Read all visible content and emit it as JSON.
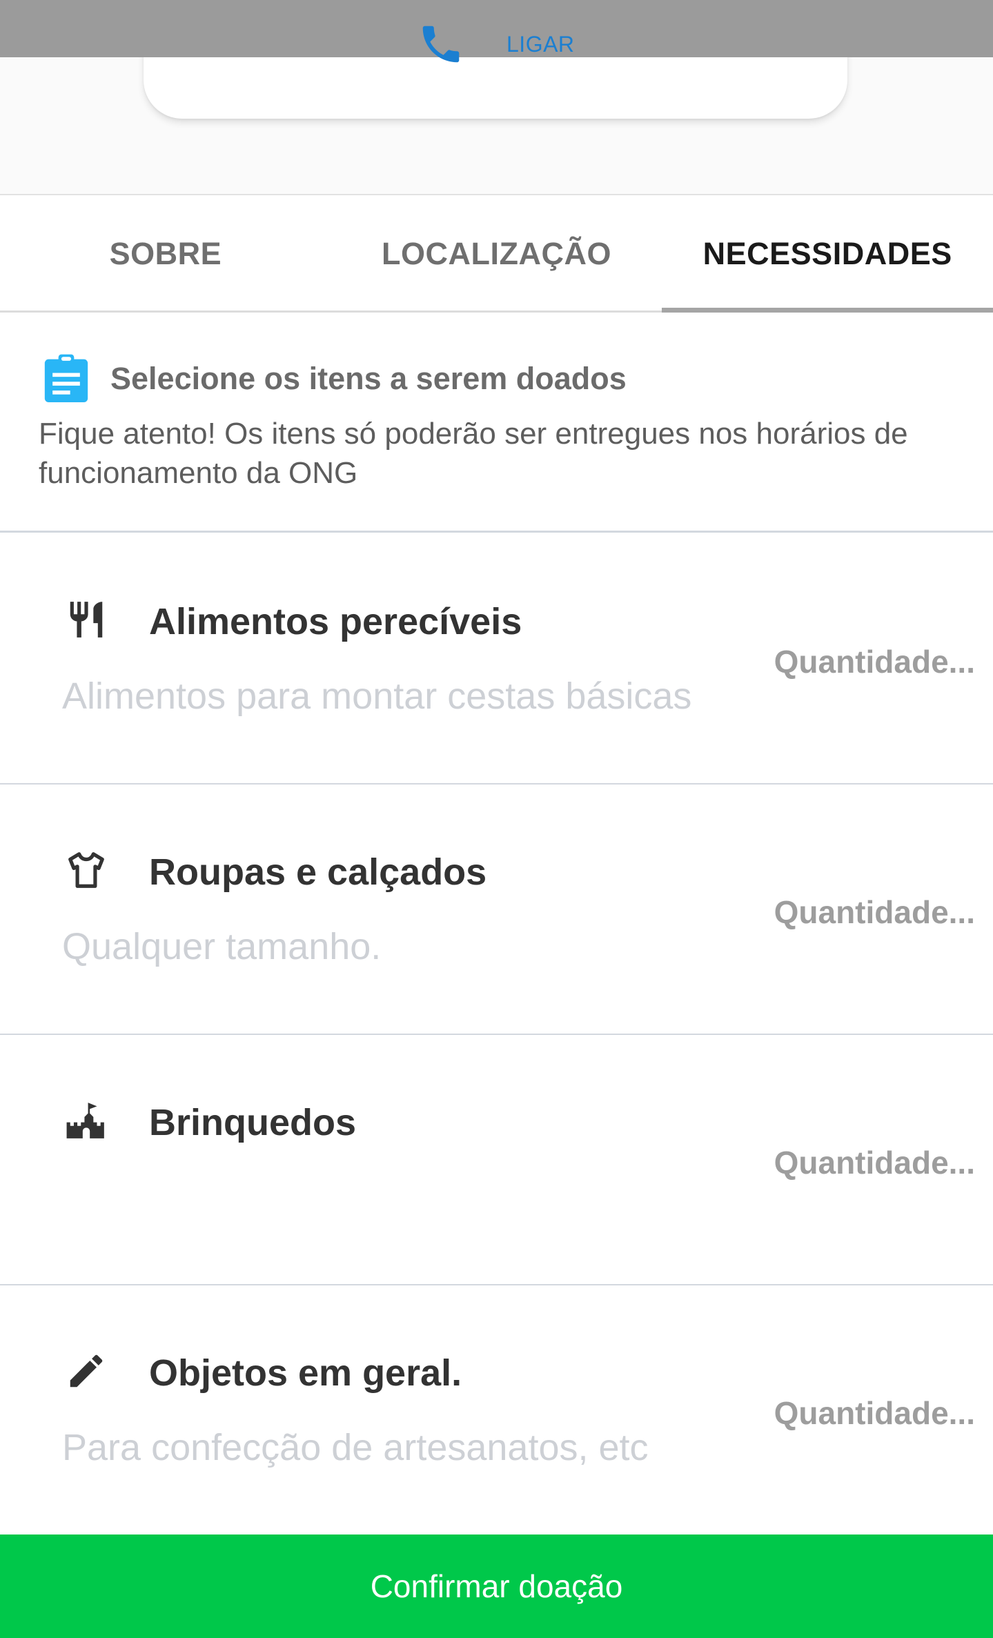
{
  "contact": {
    "call_label": "LIGAR",
    "icon": "phone-icon",
    "icon_color": "#1b7fd1"
  },
  "tabs": [
    {
      "label": "SOBRE",
      "active": false
    },
    {
      "label": "LOCALIZAÇÃO",
      "active": false
    },
    {
      "label": "NECESSIDADES",
      "active": true
    }
  ],
  "notice": {
    "icon": "clipboard-icon",
    "icon_color": "#29b6f6",
    "title": "Selecione os itens a serem doados",
    "text": "Fique atento! Os itens só poderão ser entregues nos horários de funcionamento da ONG"
  },
  "items": [
    {
      "icon": "fork-knife-icon",
      "title": "Alimentos perecíveis",
      "description": "Alimentos para montar cestas básicas",
      "quantity_placeholder": "Quantidade..."
    },
    {
      "icon": "tshirt-icon",
      "title": "Roupas e calçados",
      "description": "Qualquer tamanho.",
      "quantity_placeholder": "Quantidade..."
    },
    {
      "icon": "castle-icon",
      "title": "Brinquedos",
      "description": "",
      "quantity_placeholder": "Quantidade..."
    },
    {
      "icon": "pencil-icon",
      "title": "Objetos em geral.",
      "description": "Para confecção de artesanatos, etc",
      "quantity_placeholder": "Quantidade..."
    }
  ],
  "confirm": {
    "label": "Confirmar doação",
    "color": "#00c84a"
  }
}
